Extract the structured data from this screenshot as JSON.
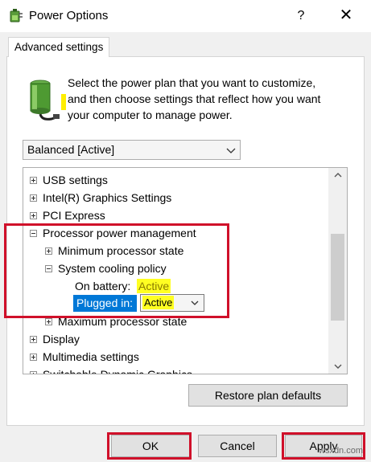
{
  "window": {
    "title": "Power Options",
    "help_glyph": "?",
    "close_glyph": "✕",
    "app_icon": "power-options-icon"
  },
  "tab": {
    "label": "Advanced settings"
  },
  "description": {
    "line1": "Select the power plan that you want to customize,",
    "line2": "and then choose settings that reflect how you want",
    "line3": "your computer to manage power.",
    "icon": "battery-plug-icon"
  },
  "plan_select": {
    "value": "Balanced [Active]"
  },
  "tree": {
    "items": [
      {
        "label": "USB settings",
        "state": "collapsed"
      },
      {
        "label": "Intel(R) Graphics Settings",
        "state": "collapsed"
      },
      {
        "label": "PCI Express",
        "state": "collapsed"
      },
      {
        "label": "Processor power management",
        "state": "expanded"
      },
      {
        "label": "Minimum processor state",
        "state": "collapsed"
      },
      {
        "label": "System cooling policy",
        "state": "expanded"
      },
      {
        "label": "Maximum processor state",
        "state": "collapsed"
      },
      {
        "label": "Display",
        "state": "collapsed"
      },
      {
        "label": "Multimedia settings",
        "state": "collapsed"
      },
      {
        "label": "Switchable Dynamic Graphics",
        "state": "collapsed"
      }
    ],
    "on_battery": {
      "label": "On battery:",
      "value": "Active"
    },
    "plugged_in": {
      "label": "Plugged in:",
      "value": "Active"
    }
  },
  "buttons": {
    "restore": "Restore plan defaults",
    "ok": "OK",
    "cancel": "Cancel",
    "apply": "Apply"
  },
  "watermark": "wsxdn.com",
  "colors": {
    "highlight_red": "#d0102a",
    "highlight_yellow": "#ffff22",
    "selection_blue": "#0078d7"
  }
}
